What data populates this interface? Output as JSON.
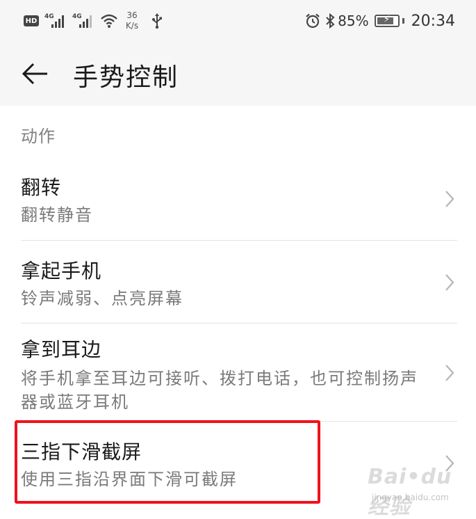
{
  "status_bar": {
    "hd_badge": "HD",
    "sim1_label": "4G",
    "sim2_label": "4G",
    "net_speed_value": "36",
    "net_speed_unit": "K/s",
    "battery_percent": "85%",
    "battery_level": 0.85,
    "time": "20:34",
    "icons": [
      "hd-icon",
      "signal-icon",
      "signal-icon",
      "wifi-icon",
      "usb-icon",
      "alarm-icon",
      "bluetooth-icon",
      "battery-charging-icon"
    ]
  },
  "header": {
    "back_icon": "back-arrow-icon",
    "title": "手势控制"
  },
  "section": {
    "label": "动作"
  },
  "items": [
    {
      "title": "翻转",
      "subtitle": "翻转静音"
    },
    {
      "title": "拿起手机",
      "subtitle": "铃声减弱、点亮屏幕"
    },
    {
      "title": "拿到耳边",
      "subtitle": "将手机拿至耳边可接听、拨打电话，也可控制扬声器或蓝牙耳机"
    },
    {
      "title": "三指下滑截屏",
      "subtitle": "使用三指沿界面下滑可截屏"
    }
  ],
  "colors": {
    "highlight": "#f0121b",
    "header_bg": "#f6f6f6",
    "secondary_text": "#7a7a7a"
  },
  "watermark": {
    "text": "Baidu经验",
    "url": "jingyan.baidu.com"
  }
}
